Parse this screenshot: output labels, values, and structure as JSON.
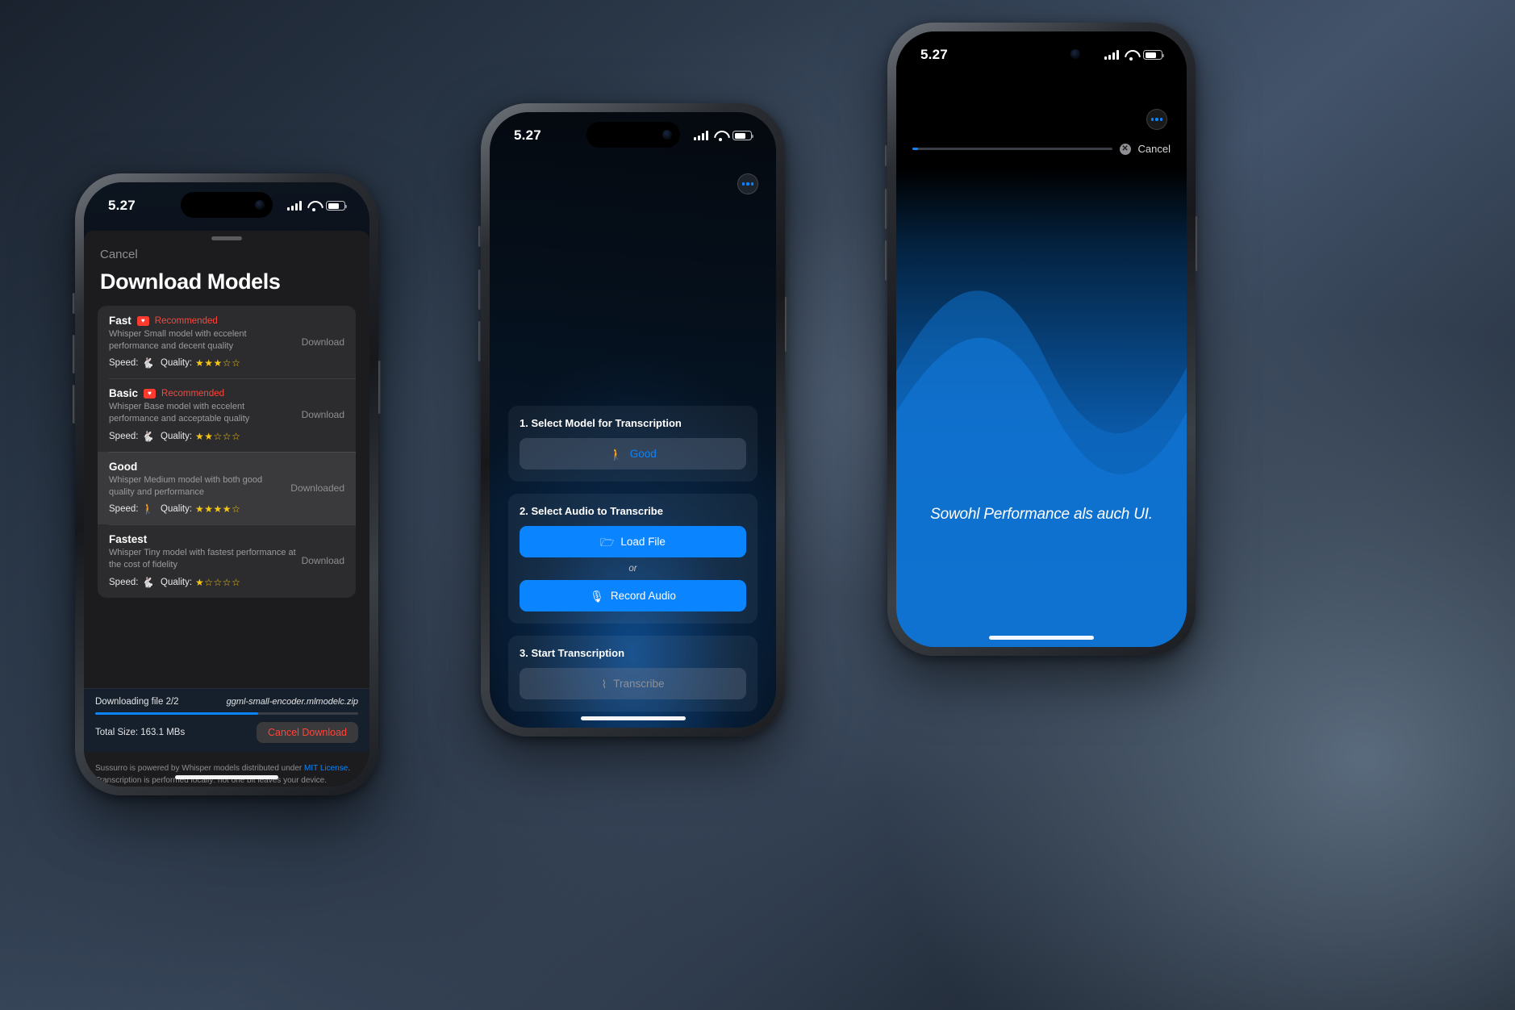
{
  "left_phone": {
    "status_bar": {
      "time": "5.27",
      "signal": "cellular-bars-icon",
      "wifi": "wifi-icon",
      "battery": "battery-icon"
    },
    "sheet": {
      "cancel_label": "Cancel",
      "title": "Download Models",
      "models": [
        {
          "name": "Fast",
          "recommended": true,
          "recommended_label": "Recommended",
          "badge_glyph": "♥",
          "description": "Whisper Small model with eccelent performance and decent quality",
          "speed_label": "Speed:",
          "speed_icon": "rabbit-icon",
          "speed_glyph": "🐇",
          "quality_label": "Quality:",
          "quality_stars": "★★★☆☆",
          "quality_value": 3,
          "action": "Download",
          "selected": false
        },
        {
          "name": "Basic",
          "recommended": true,
          "recommended_label": "Recommended",
          "badge_glyph": "♥",
          "description": "Whisper Base model with eccelent performance and acceptable quality",
          "speed_label": "Speed:",
          "speed_icon": "rabbit-icon",
          "speed_glyph": "🐇",
          "quality_label": "Quality:",
          "quality_stars": "★★☆☆☆",
          "quality_value": 2,
          "action": "Download",
          "selected": false
        },
        {
          "name": "Good",
          "recommended": false,
          "recommended_label": "",
          "badge_glyph": "",
          "description": "Whisper Medium model with both good quality and performance",
          "speed_label": "Speed:",
          "speed_icon": "walking-person-icon",
          "speed_glyph": "🚶",
          "quality_label": "Quality:",
          "quality_stars": "★★★★☆",
          "quality_value": 4,
          "action": "Downloaded",
          "selected": true
        },
        {
          "name": "Fastest",
          "recommended": false,
          "recommended_label": "",
          "badge_glyph": "",
          "description": "Whisper Tiny model with fastest performance at the cost of fidelity",
          "speed_label": "Speed:",
          "speed_icon": "rabbit-icon",
          "speed_glyph": "🐇",
          "quality_label": "Quality:",
          "quality_stars": "★☆☆☆☆",
          "quality_value": 1,
          "action": "Download",
          "selected": false
        }
      ],
      "download_panel": {
        "status": "Downloading file 2/2",
        "file_name": "ggml-small-encoder.mlmodelc.zip",
        "progress_percent": 62,
        "total_size": "Total Size: 163.1 MBs",
        "cancel_button": "Cancel Download"
      },
      "footer": {
        "line1_before": "Sussurro is powered by Whisper models distributed under ",
        "license_link": "MIT License",
        "line1_after": ".",
        "line2": "Transcription is performed locally: not one bit leaves your device."
      }
    }
  },
  "mid_phone": {
    "status_bar": {
      "time": "5.27",
      "signal": "cellular-bars-icon",
      "wifi": "wifi-icon",
      "battery": "battery-icon"
    },
    "menu_icon": "more-options-icon",
    "cards": [
      {
        "title": "1. Select Model for Transcription",
        "button_label": "Good",
        "button_icon": "walking-person-icon",
        "button_glyph": "🚶",
        "style": "muted"
      },
      {
        "title": "2. Select Audio to Transcribe",
        "button_label": "Load File",
        "button_icon": "folder-icon",
        "button_glyph": "🗁",
        "separator": "or",
        "button2_label": "Record Audio",
        "button2_icon": "microphone-icon",
        "button2_glyph": "🎙",
        "style": "blue"
      },
      {
        "title": "3. Start Transcription",
        "button_label": "Transcribe",
        "button_icon": "waveform-icon",
        "button_glyph": "⌇",
        "style": "disabled"
      }
    ]
  },
  "right_phone": {
    "status_bar": {
      "time": "5.27",
      "signal": "cellular-bars-icon",
      "wifi": "wifi-icon",
      "battery": "battery-icon"
    },
    "menu_icon": "more-options-icon",
    "progress_percent": 3,
    "cancel_icon": "cancel-circle-icon",
    "cancel_glyph": "✕",
    "cancel_label": "Cancel",
    "transcript_text": "Sowohl Performance als auch UI."
  },
  "colors": {
    "accent_blue": "#0a84ff",
    "danger_red": "#ff453a",
    "star_yellow": "#f5c518",
    "rabbit_green": "#2fc14c",
    "walk_blue": "#37a0e8",
    "sheet_bg": "#1c1c1e",
    "card_bg": "#2c2c2e"
  }
}
